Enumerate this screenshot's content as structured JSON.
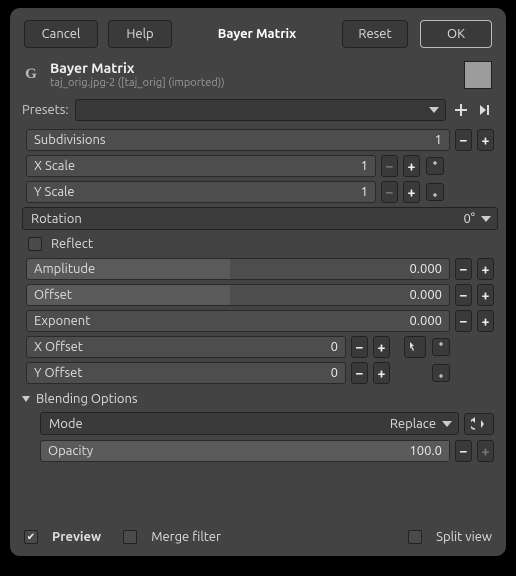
{
  "buttons": {
    "cancel": "Cancel",
    "help": "Help",
    "title_btn": "Bayer Matrix",
    "reset": "Reset",
    "ok": "OK"
  },
  "header": {
    "icon": "G",
    "title": "Bayer Matrix",
    "subtitle": "taj_orig.jpg-2 ([taj_orig] (imported))"
  },
  "presets": {
    "label": "Presets:"
  },
  "params": {
    "subdivisions": {
      "label": "Subdivisions",
      "value": "1"
    },
    "xscale": {
      "label": "X Scale",
      "value": "1"
    },
    "yscale": {
      "label": "Y Scale",
      "value": "1"
    },
    "rotation": {
      "label": "Rotation",
      "value": "0°"
    },
    "reflect": {
      "label": "Reflect"
    },
    "amplitude": {
      "label": "Amplitude",
      "value": "0.000"
    },
    "offset": {
      "label": "Offset",
      "value": "0.000"
    },
    "exponent": {
      "label": "Exponent",
      "value": "0.000"
    },
    "xoffset": {
      "label": "X Offset",
      "value": "0"
    },
    "yoffset": {
      "label": "Y Offset",
      "value": "0"
    }
  },
  "blending": {
    "title": "Blending Options",
    "mode": {
      "label": "Mode",
      "value": "Replace"
    },
    "opacity": {
      "label": "Opacity",
      "value": "100.0"
    }
  },
  "footer": {
    "preview": "Preview",
    "merge": "Merge filter",
    "split": "Split view"
  }
}
